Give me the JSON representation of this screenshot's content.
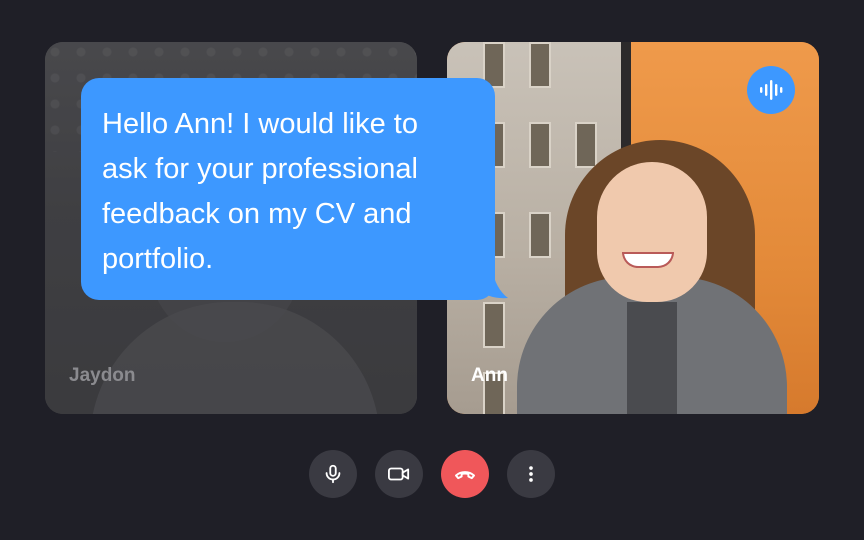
{
  "participants": [
    {
      "name": "Jaydon",
      "muted_video": true
    },
    {
      "name": "Ann",
      "speaking": true
    }
  ],
  "message": {
    "lines": [
      "Hello Ann! I would like to",
      "ask for your professional",
      "feedback on my CV and",
      "portfolio."
    ]
  },
  "colors": {
    "background": "#1f1f27",
    "accent": "#3d98ff",
    "end_call": "#f0575a",
    "control_bg": "#3a3a42"
  },
  "controls": {
    "mic_icon": "microphone-icon",
    "camera_icon": "video-camera-icon",
    "end_icon": "phone-hangup-icon",
    "more_icon": "more-vertical-icon"
  }
}
